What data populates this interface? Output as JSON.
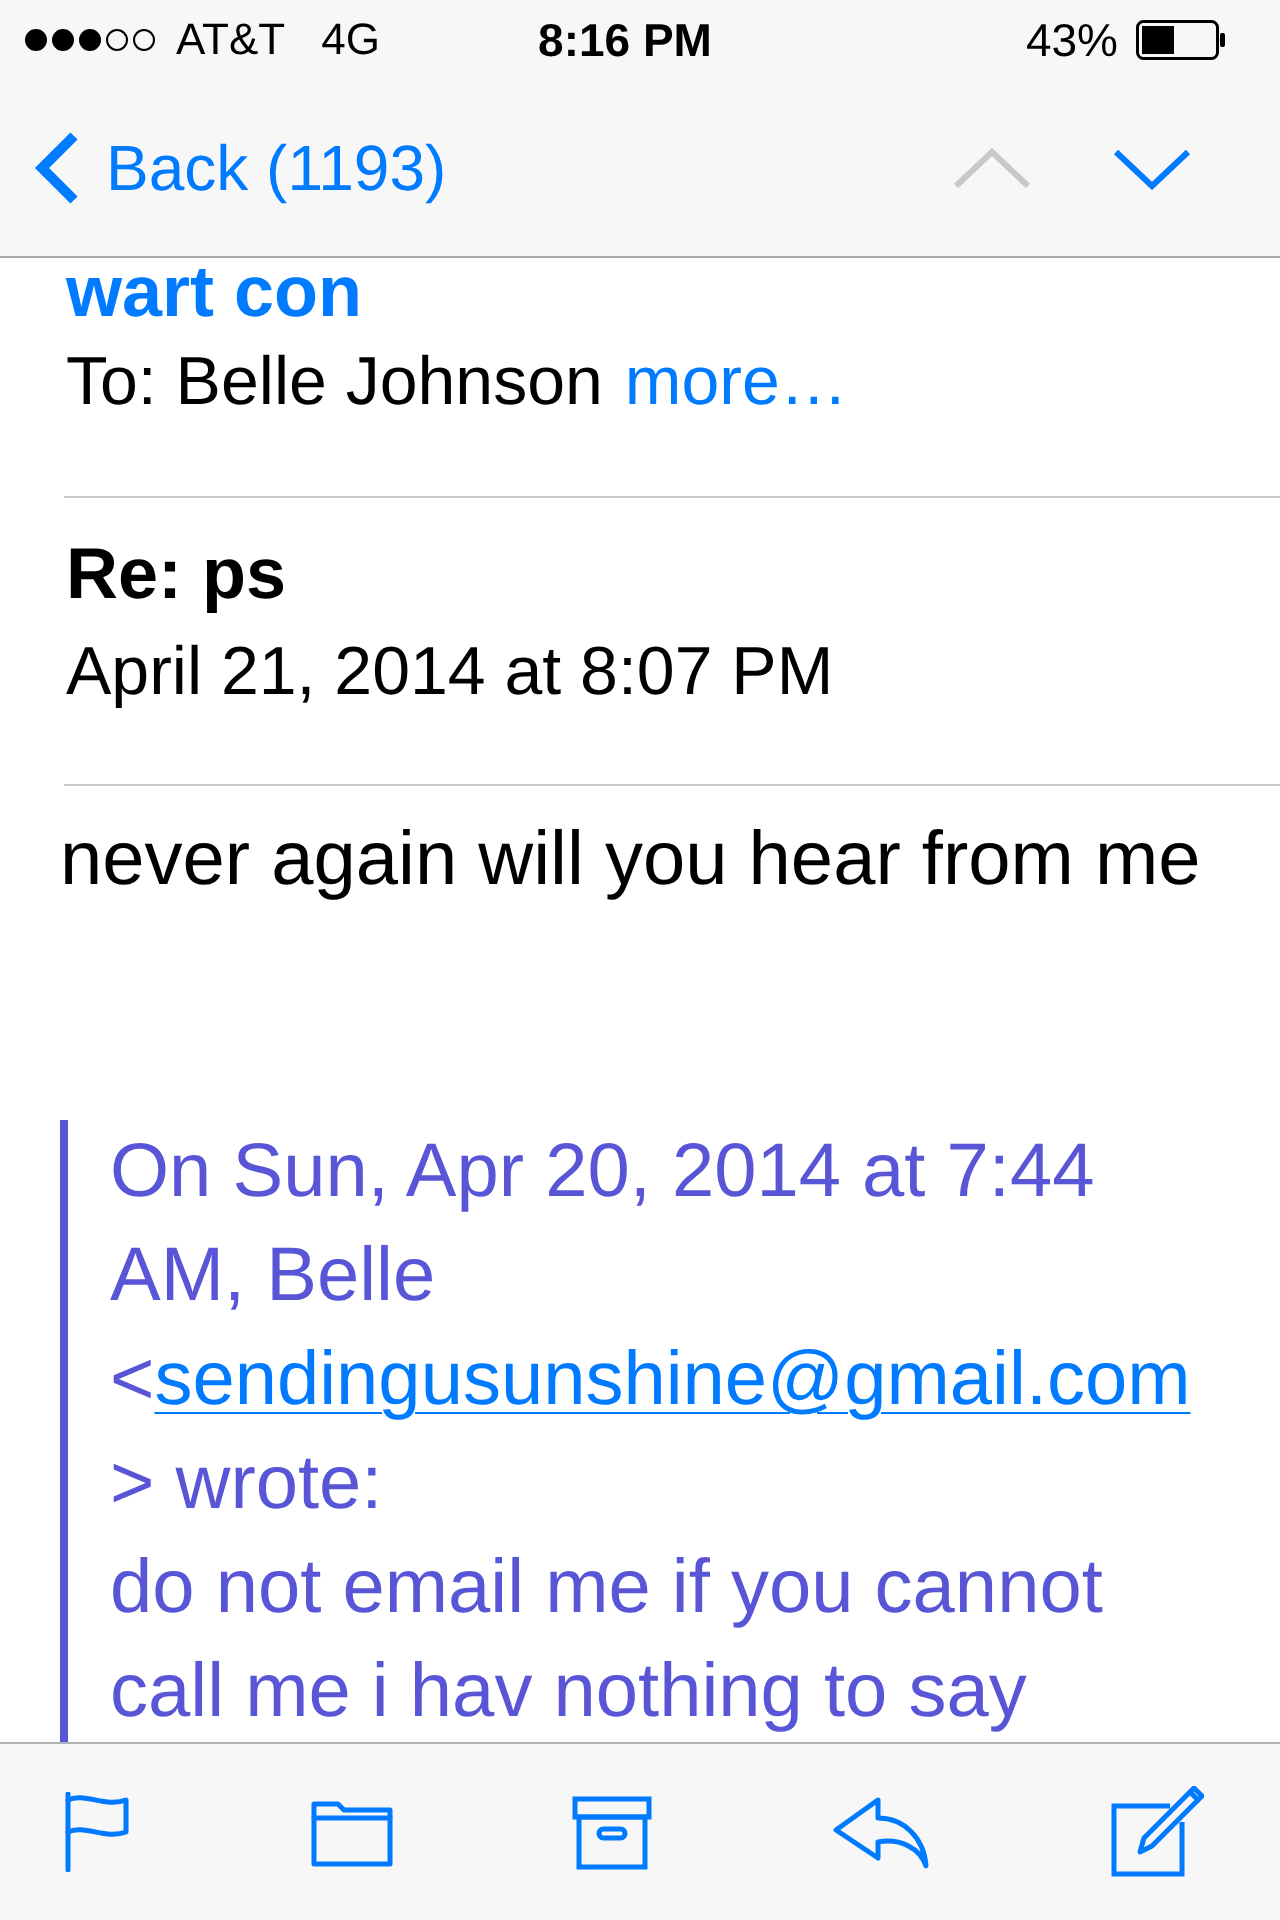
{
  "status_bar": {
    "carrier": "AT&T",
    "network": "4G",
    "time": "8:16 PM",
    "battery": "43%"
  },
  "nav_bar": {
    "back_label": "Back (1193)",
    "arrows": [
      {
        "kind": "previous",
        "disabled": true
      },
      {
        "kind": "next",
        "disabled": false
      }
    ]
  },
  "message": {
    "sender": "wart con",
    "recipients": "To: Belle Johnson",
    "more_link": "more…",
    "subject": "Re: ps",
    "date": "April 21, 2014 at 8:07 PM",
    "body": "never again will you hear from me"
  },
  "quote": {
    "attribution_before": "On Sun, Apr 20, 2014 at 7:44 AM, Belle <",
    "email": "sendingusunshine@gmail.com",
    "attribution_after": "> wrote:",
    "text": "do not email me if you cannot call me i hav nothing to say"
  },
  "toolbar": {
    "buttons": [
      {
        "kind": "flag"
      },
      {
        "kind": "folder"
      },
      {
        "kind": "archive"
      },
      {
        "kind": "reply"
      },
      {
        "kind": "compose"
      }
    ]
  }
}
